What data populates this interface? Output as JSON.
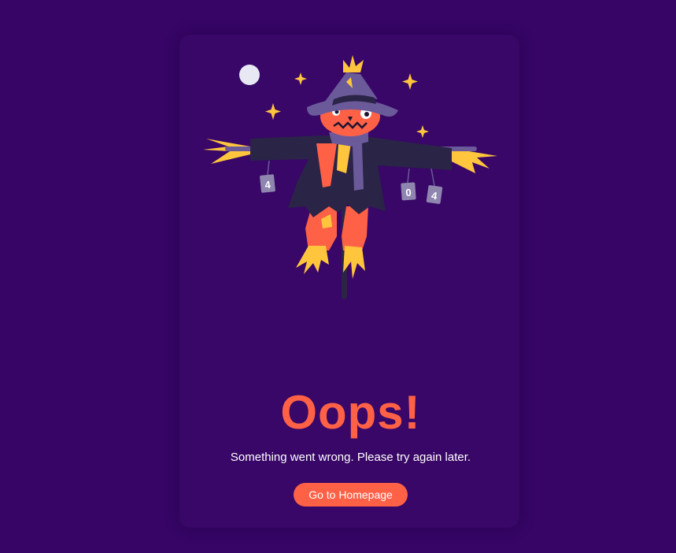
{
  "title": "Oops!",
  "message": "Something went wrong. Please try again later.",
  "button_label": "Go to Homepage",
  "cans": [
    "4",
    "0",
    "4"
  ],
  "colors": {
    "background": "#360566",
    "accent": "#ff6147",
    "text": "#ffffff",
    "coat": "#2a2447",
    "straw": "#ffc53d",
    "hat": "#6b5a9a",
    "moon": "#e8e8f5"
  }
}
